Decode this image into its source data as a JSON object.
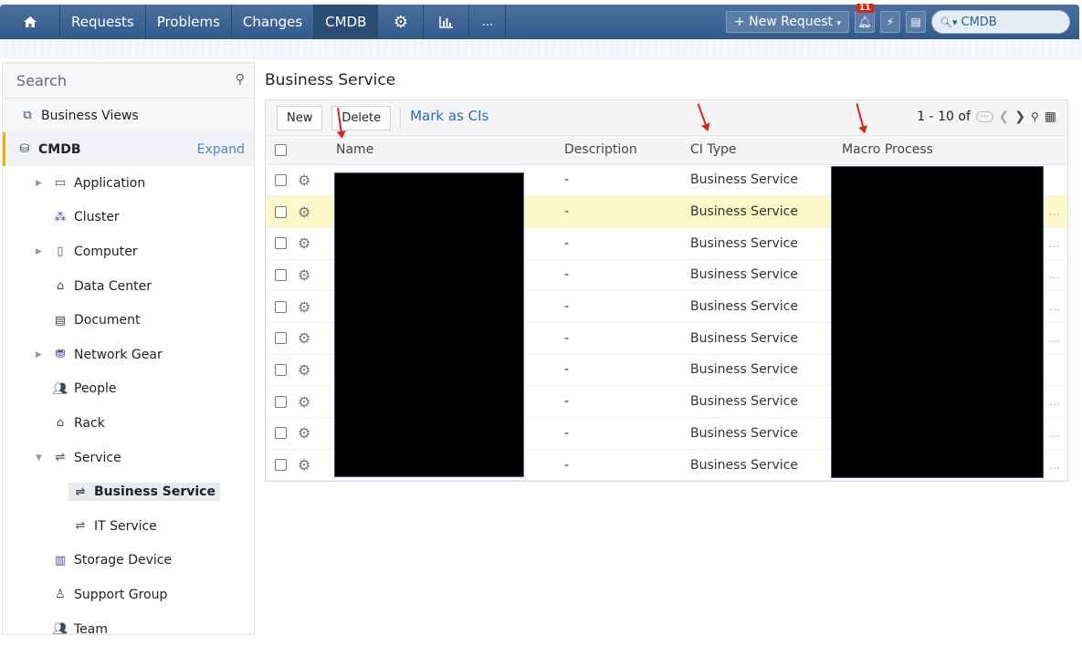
{
  "topnav": {
    "items": [
      {
        "label": "Requests"
      },
      {
        "label": "Problems"
      },
      {
        "label": "Changes"
      },
      {
        "label": "CMDB"
      }
    ],
    "more_label": "...",
    "new_request_label": "+ New Request",
    "notification_count": "11",
    "search_scope": "CMDB",
    "icons": [
      "home-icon",
      "gear-icon",
      "reports-icon",
      "bell-icon",
      "lightning-icon",
      "notes-icon",
      "search-icon"
    ]
  },
  "sidebar": {
    "search_placeholder": "Search",
    "business_views_label": "Business Views",
    "cmdb_label": "CMDB",
    "expand_label": "Expand",
    "items": [
      {
        "label": "Application",
        "has_arrow": true,
        "icon": "application-icon"
      },
      {
        "label": "Cluster",
        "has_arrow": false,
        "icon": "cluster-icon"
      },
      {
        "label": "Computer",
        "has_arrow": true,
        "icon": "computer-icon"
      },
      {
        "label": "Data Center",
        "has_arrow": false,
        "icon": "datacenter-icon"
      },
      {
        "label": "Document",
        "has_arrow": false,
        "icon": "document-icon"
      },
      {
        "label": "Network Gear",
        "has_arrow": true,
        "icon": "network-gear-icon"
      },
      {
        "label": "People",
        "has_arrow": false,
        "icon": "people-icon"
      },
      {
        "label": "Rack",
        "has_arrow": false,
        "icon": "rack-icon"
      },
      {
        "label": "Service",
        "has_arrow": true,
        "expanded": true,
        "icon": "service-icon"
      }
    ],
    "service_children": [
      {
        "label": "Business Service",
        "selected": true
      },
      {
        "label": "IT Service",
        "selected": false
      }
    ],
    "after_items": [
      {
        "label": "Storage Device",
        "icon": "storage-icon"
      },
      {
        "label": "Support Group",
        "icon": "support-group-icon"
      },
      {
        "label": "Team",
        "icon": "team-icon"
      }
    ]
  },
  "main": {
    "title": "Business Service",
    "toolbar": {
      "new_label": "New",
      "delete_label": "Delete",
      "mark_label": "Mark as CIs"
    },
    "pager": {
      "range": "1 - 10 of",
      "more": "···"
    },
    "columns": [
      "Name",
      "Description",
      "CI Type",
      "Macro Process"
    ],
    "rows": [
      {
        "description": "-",
        "ci_type": "Business Service",
        "trailing": ""
      },
      {
        "description": "-",
        "ci_type": "Business Service",
        "trailing": "..."
      },
      {
        "description": "-",
        "ci_type": "Business Service",
        "trailing": "..."
      },
      {
        "description": "-",
        "ci_type": "Business Service",
        "trailing": "..."
      },
      {
        "description": "-",
        "ci_type": "Business Service",
        "trailing": "..."
      },
      {
        "description": "-",
        "ci_type": "Business Service",
        "trailing": "..."
      },
      {
        "description": "-",
        "ci_type": "Business Service",
        "trailing": ""
      },
      {
        "description": "-",
        "ci_type": "Business Service",
        "trailing": "..."
      },
      {
        "description": "-",
        "ci_type": "Business Service",
        "trailing": "..."
      },
      {
        "description": "-",
        "ci_type": "Business Service",
        "trailing": "..."
      }
    ]
  }
}
